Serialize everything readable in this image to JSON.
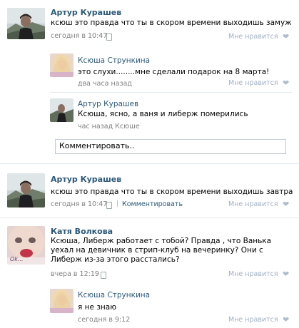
{
  "posts": [
    {
      "author": "Артур Курашев",
      "text": "ксюш это правда что ты в скором времени выходишь замуж",
      "time": "сегодня в 10:47",
      "likes": "Мне нравится",
      "replies": [
        {
          "author": "Ксюша Стрункина",
          "text": "это слухи........мне сделали подарок на 8 марта!",
          "time": "два часа назад",
          "likes": "Мне нравится"
        },
        {
          "author": "Артур Курашев",
          "text": "Ксюша, ясно, а ваня и либерж померились",
          "time": "час назад Ксюше"
        }
      ],
      "comment_placeholder": "Комментировать.."
    },
    {
      "author": "Артур Курашев",
      "text": "ксюш это правда что ты в скором времени выходишь завтра",
      "time": "сегодня в 10:47",
      "comment_link": "Комментировать",
      "likes": "Мне нравится"
    },
    {
      "author": "Катя Волкова",
      "text": "Ксюша, Либерж работает с тобой? Правда , что Ванька уехал на девичник в стрип-клуб на вечеринку? Они с Либерж из-за этого расстались?",
      "time": "вчера в 12:19",
      "likes": "Мне нравится",
      "avatar_caption": "Ok...",
      "replies": [
        {
          "author": "Ксюша Стрункина",
          "text": "я не знаю",
          "time": "сегодня в 9:12",
          "likes": "Мне нравится"
        }
      ]
    }
  ],
  "colors": {
    "link": "#2b587a",
    "meta": "#808080",
    "like": "#a0b1c4",
    "divider": "#e4e8ed",
    "input_border": "#c0cad5"
  }
}
